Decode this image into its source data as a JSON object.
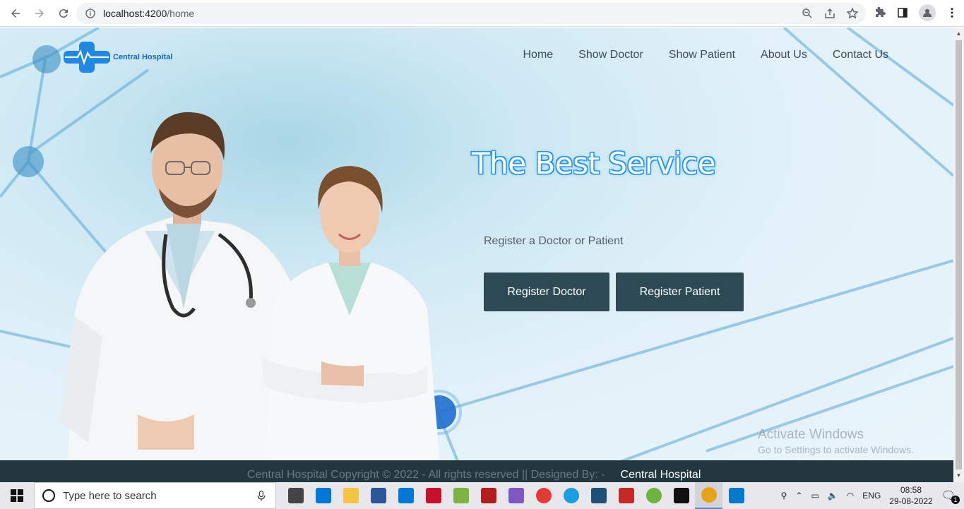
{
  "browser": {
    "url_host": "localhost:4200",
    "url_path": "/home"
  },
  "site": {
    "logo_text": "Central Hospital",
    "nav": [
      "Home",
      "Show Doctor",
      "Show Patient",
      "About Us",
      "Contact Us"
    ],
    "hero_title": "The Best Service",
    "hero_subtitle": "Register a Doctor or Patient",
    "btn_doctor": "Register Doctor",
    "btn_patient": "Register Patient",
    "footer_text": "Central Hospital Copyright © 2022 - All rights reserved || Designed By:   -",
    "footer_strong": "Central Hospital"
  },
  "watermark": {
    "line1": "Activate Windows",
    "line2": "Go to Settings to activate Windows."
  },
  "taskbar": {
    "search_placeholder": "Type here to search",
    "lang": "ENG",
    "time": "08:58",
    "date": "29-08-2022",
    "notif_count": "1",
    "apps": [
      {
        "name": "task-view",
        "color": "#444"
      },
      {
        "name": "store",
        "color": "#0078d7"
      },
      {
        "name": "file-explorer",
        "color": "#f5c542"
      },
      {
        "name": "word",
        "color": "#2b579a"
      },
      {
        "name": "mail",
        "color": "#0078d7"
      },
      {
        "name": "paint",
        "color": "#c8102e"
      },
      {
        "name": "notepad-plus",
        "color": "#7cb342"
      },
      {
        "name": "office-app",
        "color": "#b71c1c"
      },
      {
        "name": "cube-app",
        "color": "#7e57c2"
      },
      {
        "name": "opera",
        "color": "#e53935"
      },
      {
        "name": "edge",
        "color": "#1b9de2"
      },
      {
        "name": "mysql",
        "color": "#1e4f7a"
      },
      {
        "name": "flag-app",
        "color": "#c62828"
      },
      {
        "name": "spring",
        "color": "#6db33f"
      },
      {
        "name": "terminal",
        "color": "#111"
      },
      {
        "name": "chrome",
        "color": "#e8a317"
      },
      {
        "name": "vscode",
        "color": "#007acc"
      }
    ]
  }
}
